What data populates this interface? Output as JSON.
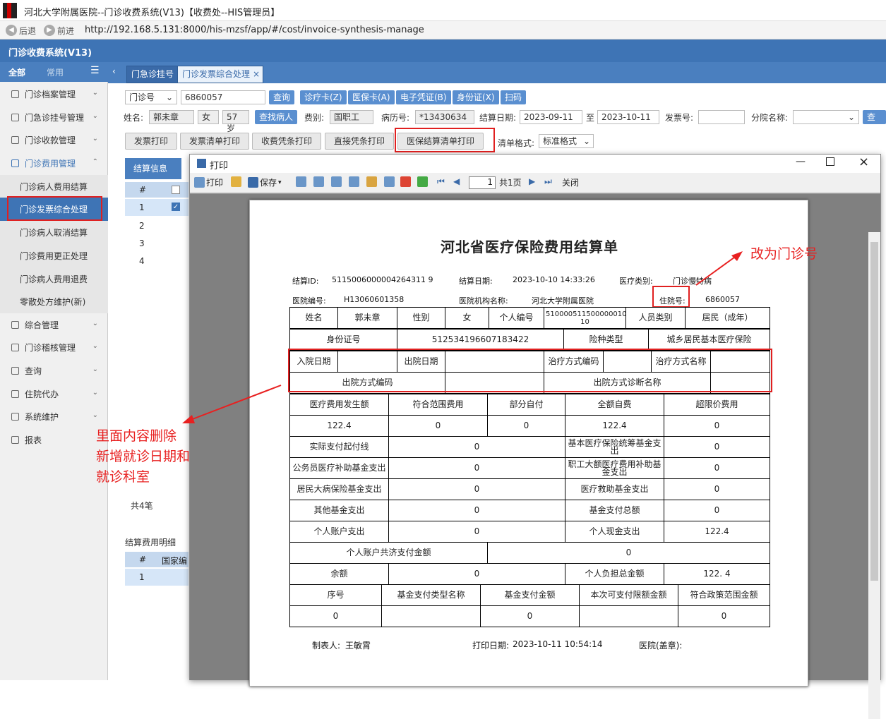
{
  "window": {
    "title": "河北大学附属医院--门诊收费系统(V13)【收费处--HIS管理员】"
  },
  "browser": {
    "back": "后退",
    "forward": "前进",
    "url": "http://192.168.5.131:8000/his-mzsf/app/#/cost/invoice-synthesis-manage"
  },
  "app": {
    "title": "门诊收费系统(V13)"
  },
  "sidebar": {
    "tab_all": "全部",
    "tab_common": "常用",
    "menu_icon": "menu-icon",
    "items": [
      {
        "label": "门诊档案管理"
      },
      {
        "label": "门急诊挂号管理"
      },
      {
        "label": "门诊收款管理"
      },
      {
        "label": "门诊费用管理"
      }
    ],
    "subitems": [
      {
        "label": "门诊病人费用结算"
      },
      {
        "label": "门诊发票综合处理"
      },
      {
        "label": "门诊病人取消结算"
      },
      {
        "label": "门诊费用更正处理"
      },
      {
        "label": "门诊病人费用退费"
      },
      {
        "label": "零散处方维护(新)"
      }
    ],
    "items2": [
      {
        "label": "综合管理"
      },
      {
        "label": "门诊稽核管理"
      },
      {
        "label": "查询"
      },
      {
        "label": "住院代办"
      },
      {
        "label": "系统维护"
      },
      {
        "label": "报表"
      }
    ]
  },
  "tabs": [
    {
      "label": "门急诊挂号"
    },
    {
      "label": "门诊发票综合处理"
    }
  ],
  "search": {
    "type": "门诊号",
    "value": "6860057",
    "buttons": [
      "查询",
      "诊疗卡(Z)",
      "医保卡(A)",
      "电子凭证(B)",
      "身份证(X)",
      "扫码"
    ]
  },
  "patient": {
    "name_label": "姓名:",
    "name": "郭未章",
    "sex": "女",
    "age": "57岁",
    "find_button": "查找病人",
    "feetype_label": "费别:",
    "feetype": "国职工",
    "record_label": "病历号:",
    "record": "*13430634",
    "date_label": "结算日期:",
    "date_from": "2023-09-11",
    "date_to_label": "至",
    "date_to": "2023-10-11",
    "invoice_label": "发票号:",
    "branch_label": "分院名称:",
    "search_btn": "查"
  },
  "actions": [
    "发票打印",
    "发票清单打印",
    "收费凭条打印",
    "直接凭条打印",
    "医保结算清单打印"
  ],
  "list_format": {
    "label": "清单格式:",
    "value": "标准格式"
  },
  "settle": {
    "header": "结算信息",
    "col_num": "#",
    "rows": [
      "1",
      "2",
      "3",
      "4"
    ],
    "total": "共4笔"
  },
  "detail": {
    "header": "结算费用明细",
    "col_num": "#",
    "col_code": "国家编",
    "rows": [
      "1"
    ]
  },
  "print_window": {
    "title": "打印",
    "toolbar": {
      "print": "打印",
      "save": "保存",
      "page": "1",
      "pages": "共1页",
      "close": "关闭"
    }
  },
  "document": {
    "title": "河北省医疗保险费用结算单",
    "settle_id_label": "结算ID:",
    "settle_id": "5115006000004264311 9",
    "settle_date_label": "结算日期:",
    "settle_date": "2023-10-10 14:33:26",
    "med_type_label": "医疗类别:",
    "med_type": "门诊慢特病",
    "hosp_code_label": "医院编号:",
    "hosp_code": "H13060601358",
    "hosp_name_label": "医院机构名称:",
    "hosp_name": "河北大学附属医院",
    "inpatient_label": "住院号:",
    "inpatient": "6860057",
    "r1": [
      "姓名",
      "郭未章",
      "性别",
      "女",
      "个人编号",
      "510000511500000010013541 10",
      "人员类别",
      "居民（成年）"
    ],
    "r2": [
      "身份证号",
      "512534196607183422",
      "险种类型",
      "城乡居民基本医疗保险"
    ],
    "r3": [
      "入院日期",
      "",
      "出院日期",
      "",
      "治疗方式编码",
      "",
      "治疗方式名称",
      ""
    ],
    "r4": [
      "出院方式编码",
      "",
      "出院方式诊断名称",
      ""
    ],
    "r5": [
      "医疗费用发生额",
      "符合范围费用",
      "部分自付",
      "全额自费",
      "超限价费用"
    ],
    "r6": [
      "122.4",
      "0",
      "0",
      "122.4",
      "0"
    ],
    "r7": [
      "实际支付起付线",
      "0",
      "基本医疗保险统筹基金支出",
      "0"
    ],
    "r8": [
      "公务员医疗补助基金支出",
      "0",
      "职工大额医疗费用补助基金支出",
      "0"
    ],
    "r9": [
      "居民大病保险基金支出",
      "0",
      "医疗救助基金支出",
      "0"
    ],
    "r10": [
      "其他基金支出",
      "0",
      "基金支付总额",
      "0"
    ],
    "r11": [
      "个人账户支出",
      "0",
      "个人现金支出",
      "122.4"
    ],
    "r12": [
      "个人账户共济支付金额",
      "0"
    ],
    "r13": [
      "余额",
      "0",
      "个人负担总金额",
      "122. 4"
    ],
    "r14": [
      "序号",
      "基金支付类型名称",
      "基金支付金额",
      "本次可支付限额金额",
      "符合政策范围金额"
    ],
    "r15": [
      "0",
      "",
      "0",
      "",
      "0"
    ],
    "maker_label": "制表人:",
    "maker": "王敏霄",
    "print_date_label": "打印日期:",
    "print_date": "2023-10-11 10:54:14",
    "hospital_seal": "医院(盖章):"
  },
  "annotations": {
    "a1": "改为门诊号",
    "a2": "里面内容删除\n新增就诊日期和\n就诊科室"
  },
  "colors": {
    "accent": "#3e74b5",
    "annotation": "#e82020"
  }
}
